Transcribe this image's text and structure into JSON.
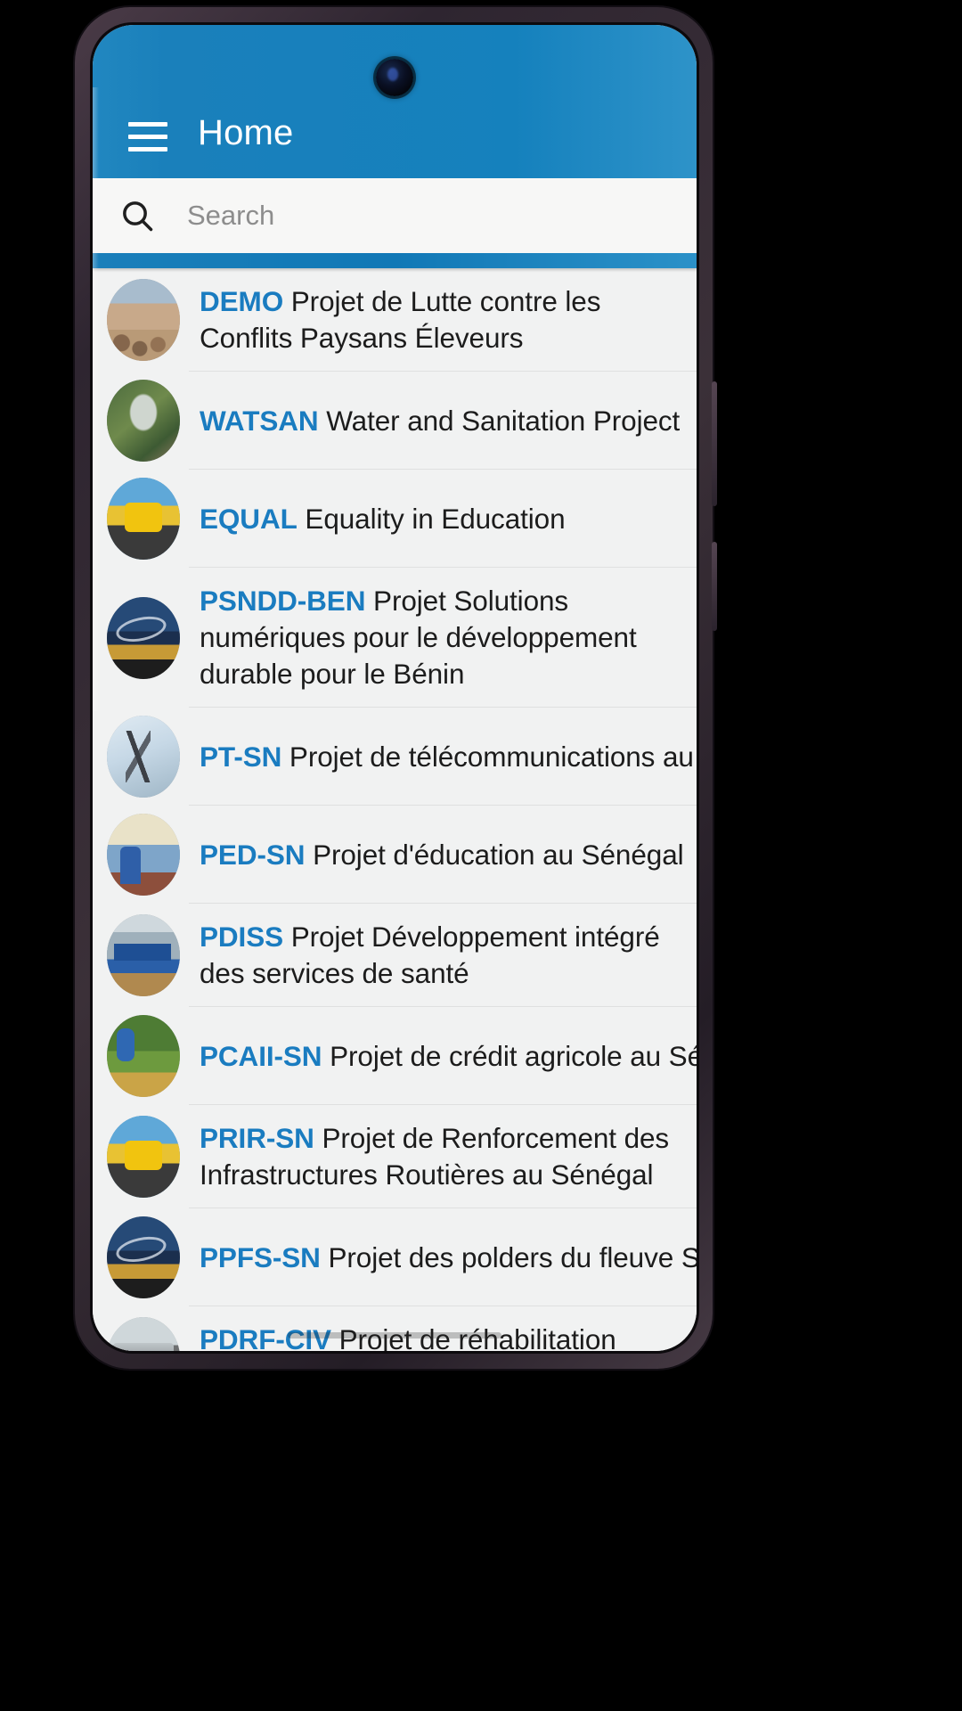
{
  "app": {
    "title": "Home",
    "menu_icon": "hamburger-menu-icon",
    "accent_color": "#1a7fba",
    "code_color": "#1a7cc0"
  },
  "search": {
    "placeholder": "Search",
    "value": "",
    "icon": "search-icon"
  },
  "projects": [
    {
      "code": "DEMO",
      "title": "Projet de Lutte contre les Conflits Paysans Éleveurs",
      "wrap": true,
      "thumb": "art-demo",
      "thumb_name": "project-thumbnail-demo"
    },
    {
      "code": "WATSAN",
      "title": "Water and Sanitation Project",
      "wrap": false,
      "thumb": "art-watsan",
      "thumb_name": "project-thumbnail-watsan"
    },
    {
      "code": "EQUAL",
      "title": "Equality in Education",
      "wrap": false,
      "thumb": "art-equal",
      "thumb_name": "project-thumbnail-equal"
    },
    {
      "code": "PSNDD-BEN",
      "title": "Projet Solutions numériques pour le développement durable pour le Bénin",
      "wrap": true,
      "thumb": "art-polder",
      "thumb_name": "project-thumbnail-psndd-ben"
    },
    {
      "code": "PT-SN",
      "title": "Projet de télécommunications au Sénégal",
      "wrap": false,
      "thumb": "art-telecom",
      "thumb_name": "project-thumbnail-pt-sn"
    },
    {
      "code": "PED-SN",
      "title": "Projet d'éducation au Sénégal",
      "wrap": false,
      "thumb": "art-school",
      "thumb_name": "project-thumbnail-ped-sn"
    },
    {
      "code": "PDISS",
      "title": "Projet Développement intégré des services de santé",
      "wrap": true,
      "thumb": "art-health",
      "thumb_name": "project-thumbnail-pdiss"
    },
    {
      "code": "PCAII-SN",
      "title": "Projet de crédit agricole au Sénégal",
      "wrap": false,
      "thumb": "art-agri",
      "thumb_name": "project-thumbnail-pcaii-sn"
    },
    {
      "code": "PRIR-SN",
      "title": "Projet de Renforcement des Infrastructures Routières au Sénégal",
      "wrap": true,
      "thumb": "art-roller",
      "thumb_name": "project-thumbnail-prir-sn"
    },
    {
      "code": "PPFS-SN",
      "title": "Projet des polders du fleuve Sénégal",
      "wrap": false,
      "thumb": "art-polder",
      "thumb_name": "project-thumbnail-ppfs-sn"
    },
    {
      "code": "PDRF-CIV",
      "title": "Projet de réhabilitation ferroviaire en Cote d'ivoire",
      "wrap": true,
      "thumb": "art-rail",
      "thumb_name": "project-thumbnail-pdrf-civ"
    }
  ]
}
